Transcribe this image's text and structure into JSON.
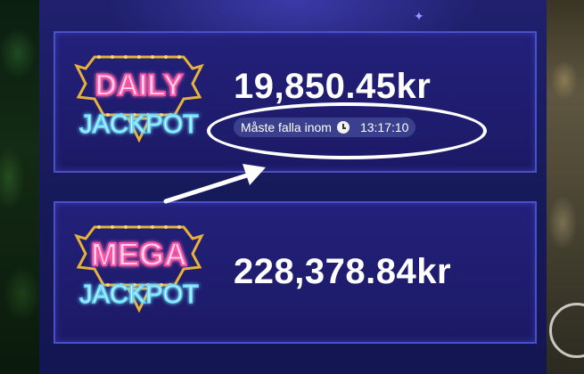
{
  "daily": {
    "logo_line1": "DAILY",
    "logo_line2": "JACKPOT",
    "amount": "19,850.45kr",
    "timer_label": "Måste falla inom",
    "timer_time": "13:17:10"
  },
  "mega": {
    "logo_line1": "MEGA",
    "logo_line2": "JACKPOT",
    "amount": "228,378.84kr"
  },
  "colors": {
    "pink_neon": "#ff4fa6",
    "blue_neon": "#5fd8ff",
    "gold": "#e8b23a",
    "panel": "#1c1a66"
  },
  "icons": {
    "timer_icon": "clock-icon",
    "annotation": "arrow-icon"
  }
}
